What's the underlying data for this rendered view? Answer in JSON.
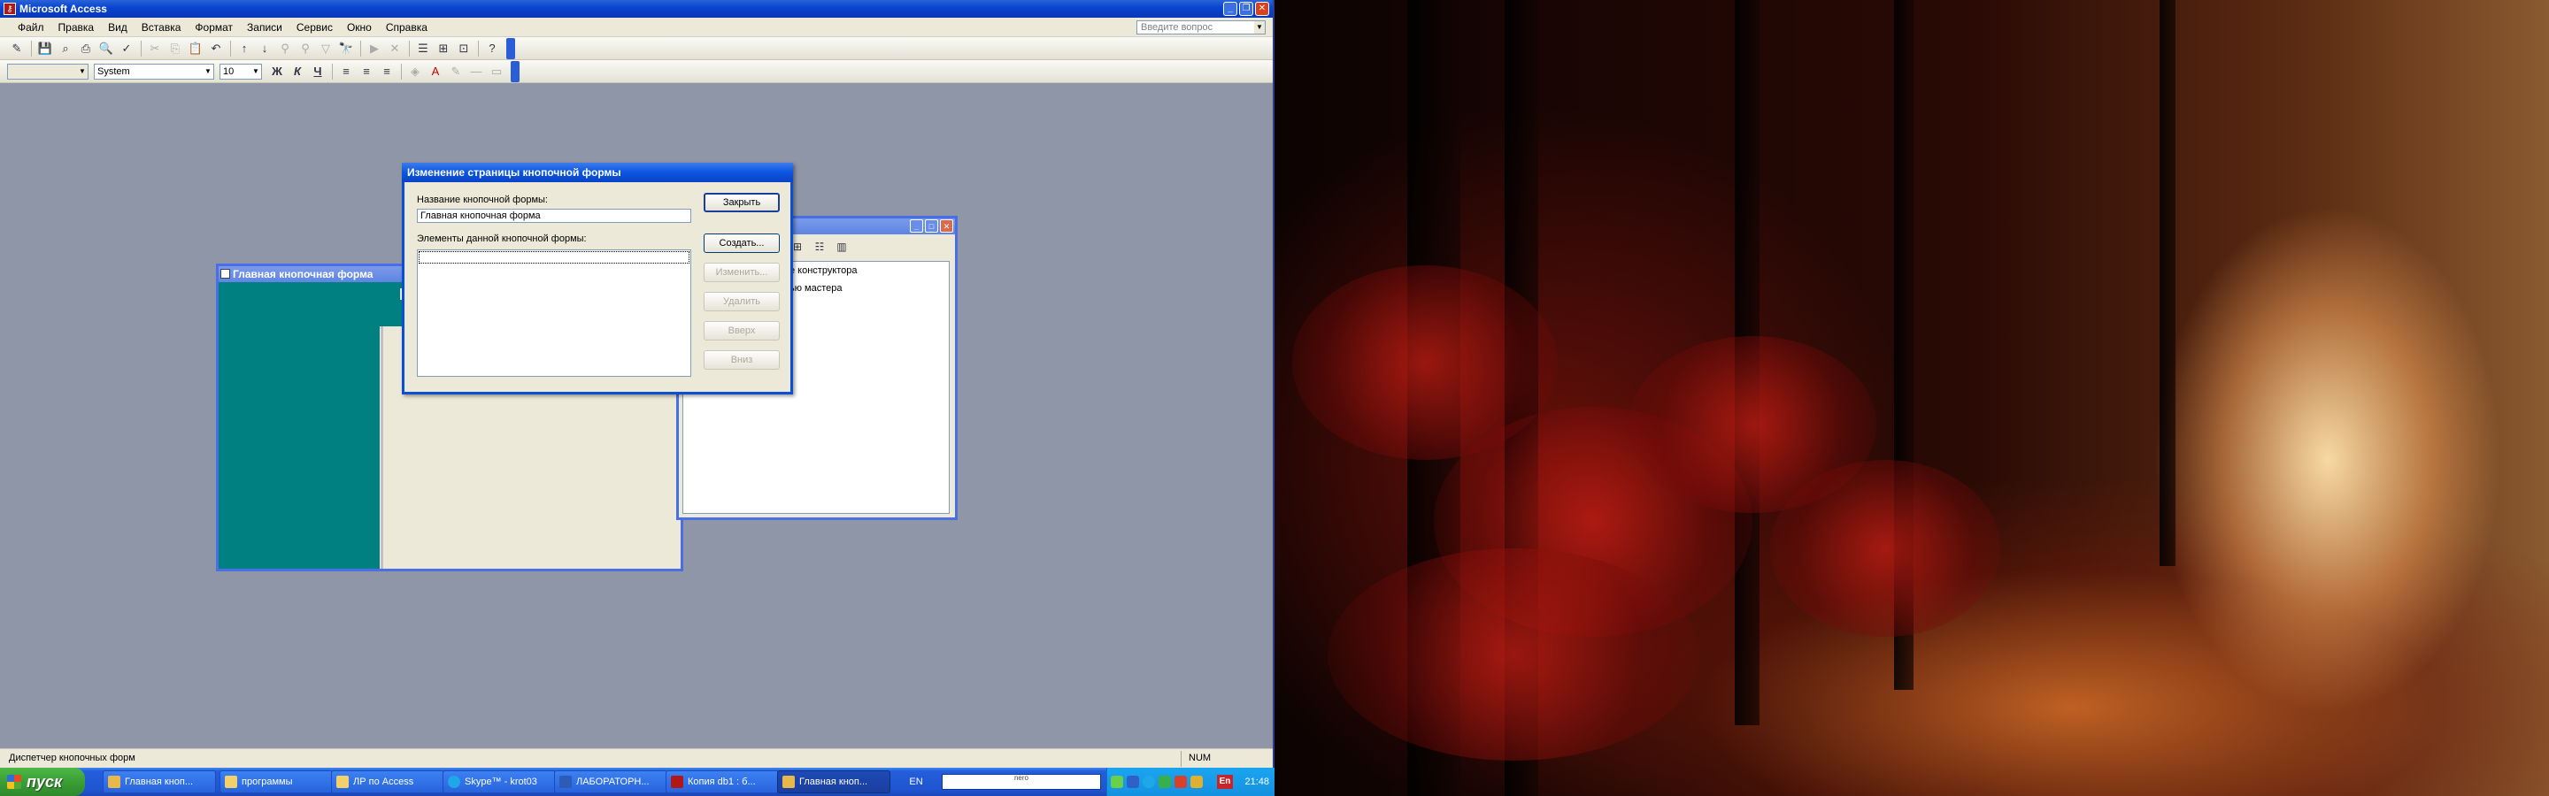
{
  "app": {
    "title": "Microsoft Access",
    "menu": [
      "Файл",
      "Правка",
      "Вид",
      "Вставка",
      "Формат",
      "Записи",
      "Сервис",
      "Окно",
      "Справка"
    ],
    "ask_placeholder": "Введите вопрос"
  },
  "formatting_toolbar": {
    "object_combo": "",
    "font_name": "System",
    "font_size": "10"
  },
  "switchboard_form": {
    "title": "Главная кнопочная форма",
    "header_char": "Г"
  },
  "manager_window": {
    "title_suffix": ")",
    "items": [
      "е конструктора",
      "ью мастера"
    ]
  },
  "edit_dialog": {
    "title": "Изменение страницы кнопочной формы",
    "name_label": "Название кнопочной формы:",
    "name_value": "Главная кнопочная форма",
    "items_label": "Элементы данной кнопочной формы:",
    "buttons": {
      "close": "Закрыть",
      "create": "Создать...",
      "edit": "Изменить...",
      "delete": "Удалить",
      "up": "Вверх",
      "down": "Вниз"
    }
  },
  "status": {
    "text": "Диспетчер кнопочных форм",
    "num": "NUM"
  },
  "taskbar": {
    "start_label": "пуск",
    "tasks": [
      {
        "label": "Главная кноп..."
      },
      {
        "label": "программы"
      },
      {
        "label": "ЛР по Access"
      },
      {
        "label": "Skype™ - krot03"
      },
      {
        "label": "ЛАБОРАТОРН..."
      },
      {
        "label": "Копия db1 : б..."
      },
      {
        "label": "Главная кноп..."
      }
    ],
    "active_task_index": 6,
    "language": "EN",
    "nero_text": "nero",
    "tray_language": "En",
    "clock": "21:48"
  },
  "colors": {
    "title_bar": "#0a46d0",
    "desktop_mdi": "#8e96a8",
    "form_teal": "#008080",
    "taskbar": "#245edb",
    "start_button": "#3a9e35"
  }
}
